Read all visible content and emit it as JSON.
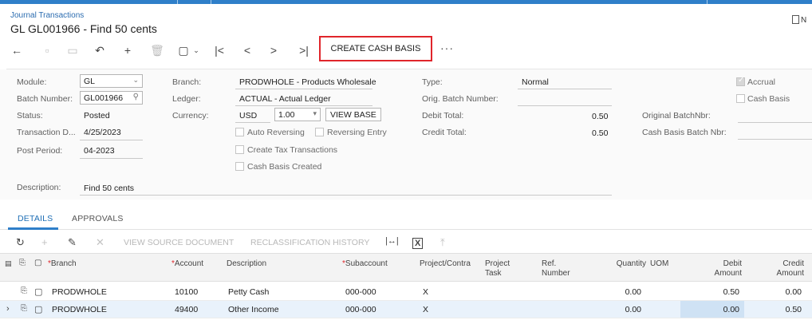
{
  "header": {
    "breadcrumb": "Journal Transactions",
    "title": "GL GL001966 - Find 50 cents",
    "notes_label": "N"
  },
  "toolbar": {
    "cash_basis_label": "CREATE CASH BASIS",
    "more_label": "···",
    "icons": [
      "back-icon",
      "save-icon",
      "save-close-icon",
      "undo-icon",
      "add-icon",
      "delete-icon",
      "copy-paste-icon",
      "first-icon",
      "prev-icon",
      "next-icon",
      "last-icon"
    ]
  },
  "form": {
    "module_label": "Module:",
    "module_value": "GL",
    "batch_number_label": "Batch Number:",
    "batch_number_value": "GL001966",
    "status_label": "Status:",
    "status_value": "Posted",
    "transaction_date_label": "Transaction D...",
    "transaction_date_value": "4/25/2023",
    "post_period_label": "Post Period:",
    "post_period_value": "04-2023",
    "description_label": "Description:",
    "description_value": "Find 50 cents",
    "branch_label": "Branch:",
    "branch_value": "PRODWHOLE - Products Wholesale",
    "ledger_label": "Ledger:",
    "ledger_value": "ACTUAL - Actual Ledger",
    "currency_label": "Currency:",
    "currency_value": "USD",
    "rate_value": "1.00",
    "view_base_label": "VIEW BASE",
    "auto_reversing_label": "Auto Reversing",
    "reversing_entry_label": "Reversing Entry",
    "create_tax_label": "Create Tax Transactions",
    "cash_basis_created_label": "Cash Basis Created",
    "type_label": "Type:",
    "type_value": "Normal",
    "orig_batch_label": "Orig. Batch Number:",
    "debit_total_label": "Debit Total:",
    "debit_total_value": "0.50",
    "credit_total_label": "Credit Total:",
    "credit_total_value": "0.50",
    "original_batchnbr_label": "Original BatchNbr:",
    "cash_basis_batch_label": "Cash Basis Batch Nbr:",
    "accrual_label": "Accrual",
    "accrual_checked": true,
    "cash_basis_label": "Cash Basis",
    "cash_basis_checked": false
  },
  "tabs": [
    {
      "label": "DETAILS",
      "active": true
    },
    {
      "label": "APPROVALS",
      "active": false
    }
  ],
  "grid_toolbar": {
    "view_source_label": "VIEW SOURCE DOCUMENT",
    "reclass_history_label": "RECLASSIFICATION HISTORY"
  },
  "grid": {
    "columns": {
      "branch": "Branch",
      "account": "Account",
      "description": "Description",
      "subaccount": "Subaccount",
      "project": "Project/Contra",
      "project_task_1": "Project",
      "project_task_2": "Task",
      "ref_number_1": "Ref.",
      "ref_number_2": "Number",
      "quantity": "Quantity",
      "uom": "UOM",
      "debit_1": "Debit",
      "debit_2": "Amount",
      "credit_1": "Credit",
      "credit_2": "Amount"
    },
    "rows": [
      {
        "branch": "PRODWHOLE",
        "account": "10100",
        "description": "Petty Cash",
        "subaccount": "000-000",
        "project": "X",
        "quantity": "0.00",
        "debit": "0.50",
        "credit": "0.00"
      },
      {
        "branch": "PRODWHOLE",
        "account": "49400",
        "description": "Other Income",
        "subaccount": "000-000",
        "project": "X",
        "quantity": "0.00",
        "debit": "0.00",
        "credit": "0.50"
      }
    ]
  }
}
